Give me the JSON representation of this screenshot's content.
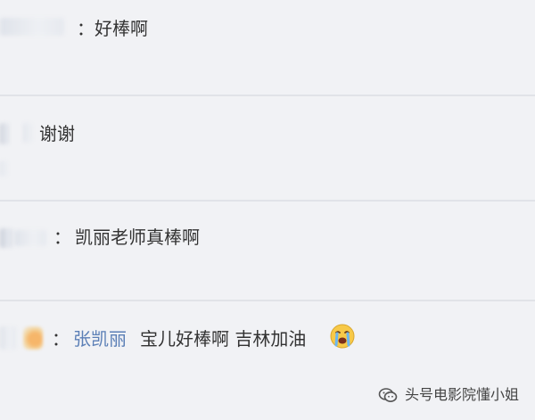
{
  "comments": [
    {
      "colon": "：",
      "text": "好棒啊"
    },
    {
      "text": "谢谢"
    },
    {
      "colon": "：",
      "text": "凯丽老师真棒啊"
    },
    {
      "colon": "：",
      "username": "张凯丽",
      "text": "宝儿好棒啊 吉林加油",
      "emoji": "crying-face-icon"
    }
  ],
  "watermark": {
    "text": "头号电影院懂小姐",
    "icon": "wechat-icon"
  },
  "colors": {
    "background": "#f1f2f5",
    "divider": "#e1e3e8",
    "username": "#5b7fb6",
    "text": "#333333"
  }
}
